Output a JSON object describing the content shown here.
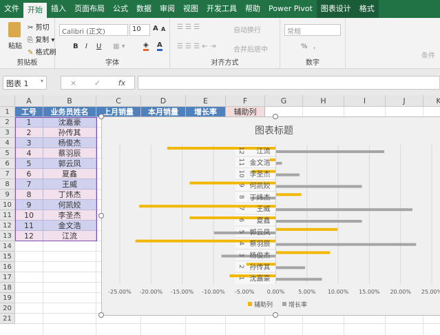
{
  "tabs": [
    "文件",
    "开始",
    "插入",
    "页面布局",
    "公式",
    "数据",
    "审阅",
    "视图",
    "开发工具",
    "帮助",
    "Power Pivot",
    "图表设计",
    "格式"
  ],
  "active_tab": "开始",
  "ribbon": {
    "clipboard": {
      "paste": "粘贴",
      "cut": "剪切",
      "copy": "复制",
      "format_painter": "格式刷",
      "label": "剪贴板"
    },
    "font": {
      "name": "Calibri (正文)",
      "size": "10",
      "bold": "B",
      "italic": "I",
      "underline": "U",
      "grow": "A",
      "shrink": "A",
      "label": "字体"
    },
    "alignment": {
      "wrap": "自动换行",
      "merge": "合并后居中",
      "label": "对齐方式"
    },
    "number": {
      "format": "常规",
      "percent": "%",
      "comma": ",",
      "label": "数字"
    },
    "styles": {
      "conditional": "条件"
    }
  },
  "formula_bar": {
    "name_box": "图表 1",
    "fx": "fx",
    "cancel": "×",
    "enter": "✓",
    "value": ""
  },
  "columns": [
    "A",
    "B",
    "C",
    "D",
    "E",
    "F",
    "G",
    "H",
    "I",
    "J",
    "K"
  ],
  "rows": [
    "1",
    "2",
    "3",
    "4",
    "5",
    "6",
    "7",
    "8",
    "9",
    "10",
    "11",
    "12",
    "13",
    "14",
    "15",
    "16",
    "17",
    "18",
    "19",
    "20",
    "21"
  ],
  "headers": [
    "工号",
    "业务员姓名",
    "上月销量",
    "本月销量",
    "增长率",
    "辅助列"
  ],
  "table": [
    [
      "1",
      "沈嘉豪"
    ],
    [
      "2",
      "孙传其"
    ],
    [
      "3",
      "杨俊杰"
    ],
    [
      "4",
      "蔡羽辰"
    ],
    [
      "5",
      "郭云凤"
    ],
    [
      "6",
      "夏鑫"
    ],
    [
      "7",
      "王威"
    ],
    [
      "8",
      "丁炜杰"
    ],
    [
      "9",
      "何凯姣"
    ],
    [
      "10",
      "李圣杰"
    ],
    [
      "11",
      "金文浩"
    ],
    [
      "12",
      "江流"
    ]
  ],
  "colors": {
    "header_blue": "#4f81bd",
    "row_blue": "#d0d0ef",
    "row_pink": "#f2e0ec",
    "helper_header": "#f4dcdc",
    "bar_yellow": "#f2b800",
    "bar_gray": "#a5a5a5",
    "excel_green": "#217346"
  },
  "chart_data": {
    "type": "bar",
    "orientation": "horizontal",
    "title": "图表标题",
    "categories": [
      [
        "1",
        "沈嘉豪"
      ],
      [
        "2",
        "孙传其"
      ],
      [
        "3",
        "杨俊杰"
      ],
      [
        "4",
        "蔡羽辰"
      ],
      [
        "5",
        "郭云凤"
      ],
      [
        "6",
        "夏鑫"
      ],
      [
        "7",
        "王威"
      ],
      [
        "8",
        "丁炜杰"
      ],
      [
        "9",
        "何凯姣"
      ],
      [
        "10",
        "李圣杰"
      ],
      [
        "11",
        "金文浩"
      ],
      [
        "12",
        "江流"
      ]
    ],
    "series": [
      {
        "name": "辅助列",
        "color": "#f2b800",
        "values": [
          -0.074,
          -0.047,
          0.087,
          -0.225,
          0.099,
          -0.138,
          -0.219,
          0.041,
          -0.138,
          -0.038,
          -0.01,
          -0.174
        ]
      },
      {
        "name": "增长率",
        "color": "#a5a5a5",
        "values": [
          0.074,
          0.047,
          -0.087,
          0.225,
          -0.099,
          0.138,
          0.219,
          -0.041,
          0.138,
          0.038,
          0.01,
          0.174
        ]
      }
    ],
    "xlim": [
      -0.25,
      0.25
    ],
    "ticks": [
      "-25.00%",
      "-20.00%",
      "-15.00%",
      "-10.00%",
      "-5.00%",
      "0.00%",
      "5.00%",
      "10.00%",
      "15.00%",
      "20.00%",
      "25.00%"
    ],
    "grid": true,
    "legend": "bottom"
  }
}
